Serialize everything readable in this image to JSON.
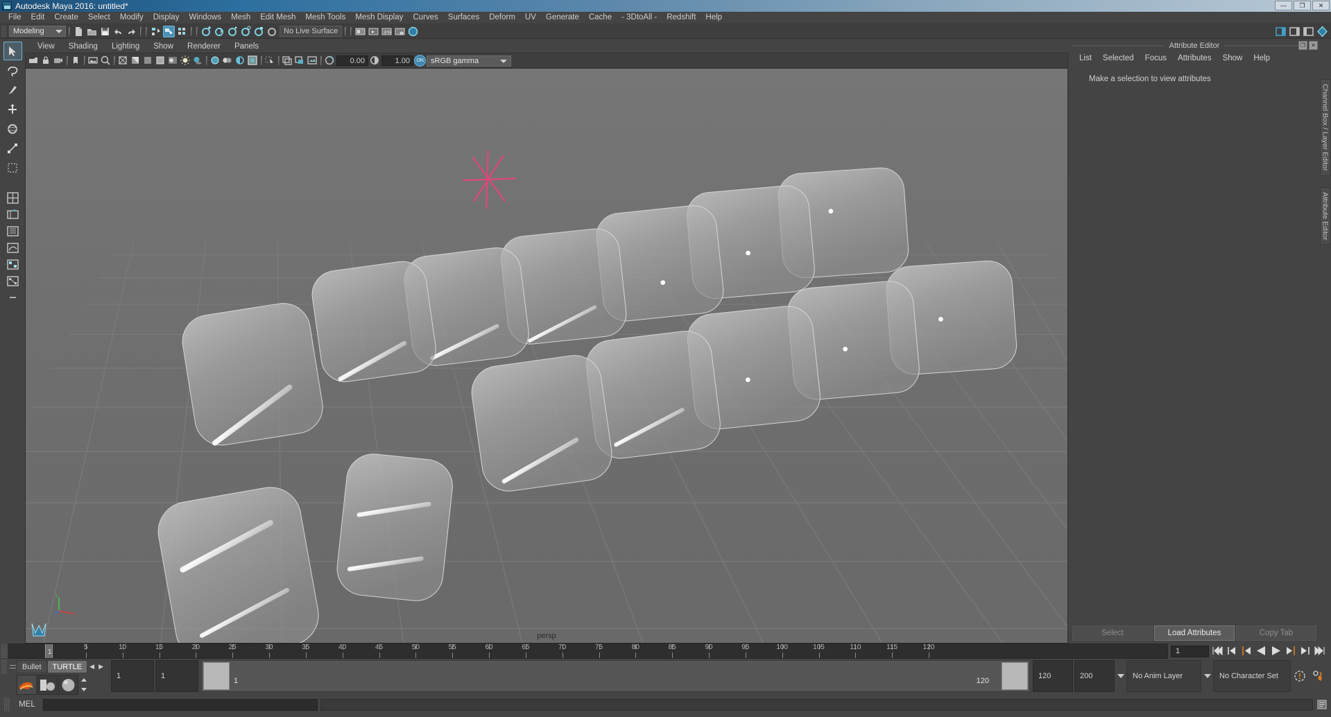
{
  "window": {
    "title": "Autodesk Maya 2016: untitled*",
    "app_icon": "maya-app-icon",
    "controls": {
      "minimize": "—",
      "maximize": "❐",
      "close": "✕"
    }
  },
  "main_menu": {
    "items": [
      "File",
      "Edit",
      "Create",
      "Select",
      "Modify",
      "Display",
      "Windows",
      "Mesh",
      "Edit Mesh",
      "Mesh Tools",
      "Mesh Display",
      "Curves",
      "Surfaces",
      "Deform",
      "UV",
      "Generate",
      "Cache",
      "- 3DtoAll -",
      "Redshift",
      "Help"
    ]
  },
  "status_line": {
    "menu_set": "Modeling",
    "live_surface": "No Live Surface",
    "icons": [
      "new-scene-icon",
      "open-scene-icon",
      "save-scene-icon",
      "undo-icon",
      "redo-icon",
      "select-by-hierarchy-icon",
      "select-by-object-icon",
      "select-by-component-icon",
      "snap-to-grid-icon",
      "snap-to-curve-icon",
      "snap-to-point-icon",
      "snap-to-projected-center-icon",
      "snap-to-view-plane-icon",
      "make-live-icon",
      "show-render-view-icon",
      "render-current-frame-icon",
      "ipr-render-icon",
      "render-settings-icon",
      "hypershade-icon"
    ],
    "right_icons": [
      "sidebar-toggle-icon",
      "attribute-editor-toggle-icon",
      "tool-settings-toggle-icon",
      "channel-box-toggle-icon"
    ]
  },
  "toolbox": {
    "items": [
      {
        "name": "select-tool",
        "active": true
      },
      {
        "name": "lasso-select-tool",
        "active": false
      },
      {
        "name": "paint-select-tool",
        "active": false
      },
      {
        "name": "move-tool",
        "active": false
      },
      {
        "name": "rotate-tool",
        "active": false
      },
      {
        "name": "scale-tool",
        "active": false
      },
      {
        "name": "last-tool-used",
        "active": false
      },
      {
        "name": "single-perspective-layout",
        "active": false
      },
      {
        "name": "four-view-layout",
        "active": false
      },
      {
        "name": "persp-outliner-layout",
        "active": false
      },
      {
        "name": "persp-graph-editor-layout",
        "active": false
      },
      {
        "name": "hypershade-persp-layout",
        "active": false
      },
      {
        "name": "persp-hypergraph-layout",
        "active": false
      },
      {
        "name": "more-layouts",
        "active": false
      }
    ]
  },
  "viewport": {
    "menus": [
      "View",
      "Shading",
      "Lighting",
      "Show",
      "Renderer",
      "Panels"
    ],
    "camera_label": "persp",
    "toolbar": {
      "exposure_value": "0.00",
      "gamma_value": "1.00",
      "color_management_toggle": "ON",
      "color_profile": "sRGB gamma",
      "icons": [
        "select-camera-icon",
        "lock-camera-icon",
        "camera-attributes-icon",
        "bookmarks-icon",
        "image-plane-icon",
        "two-d-pan-zoom-icon",
        "grid-toggle-icon",
        "film-gate-icon",
        "resolution-gate-icon",
        "gate-mask-icon",
        "xray-toggle-icon",
        "xray-joints-icon",
        "wireframe-toggle-icon",
        "smooth-shade-all-icon",
        "flat-shade-icon",
        "wireframe-on-shaded-icon",
        "texture-toggle-icon",
        "use-all-lights-icon",
        "shadows-icon",
        "screen-space-ao-icon",
        "motion-blur-icon",
        "multisample-aa-icon",
        "depth-of-field-icon",
        "isolate-select-icon",
        "grid-display-icon",
        "film-gate-display-icon",
        "exposure-icon",
        "gamma-icon"
      ]
    }
  },
  "attribute_editor": {
    "panel_title": "Attribute Editor",
    "menus": [
      "List",
      "Selected",
      "Focus",
      "Attributes",
      "Show",
      "Help"
    ],
    "empty_message": "Make a selection to view attributes",
    "buttons": [
      {
        "label": "Select",
        "enabled": false
      },
      {
        "label": "Load Attributes",
        "enabled": true
      },
      {
        "label": "Copy Tab",
        "enabled": false
      }
    ],
    "window_buttons": {
      "undock": "❐",
      "close": "✕"
    }
  },
  "vertical_tabs": [
    "Channel Box / Layer Editor",
    "Attribute Editor"
  ],
  "time_slider": {
    "current_frame": "1",
    "start_label": "1",
    "ticks": [
      5,
      10,
      15,
      20,
      25,
      30,
      35,
      40,
      45,
      50,
      55,
      60,
      65,
      70,
      75,
      80,
      85,
      90,
      95,
      100,
      105,
      110,
      115,
      120
    ],
    "frame_field": "1",
    "playback_buttons": [
      "go-to-start-icon",
      "step-back-frame-icon",
      "step-back-key-icon",
      "play-backwards-icon",
      "play-forwards-icon",
      "step-forward-key-icon",
      "step-forward-frame-icon",
      "go-to-end-icon"
    ]
  },
  "range_slider": {
    "shelf": {
      "tabs": [
        "Bullet",
        "TURTLE"
      ],
      "active_tab": "TURTLE",
      "prev_arrow": "◀",
      "next_arrow": "▶",
      "items": [
        "turtle-render-icon",
        "turtle-bake-icon",
        "turtle-sphere-icon"
      ]
    },
    "anim_start": "1",
    "anim_end_field": "1",
    "range_start": "1",
    "range_end": "120",
    "playback_end": "120",
    "anim_end": "200",
    "anim_layer": "No Anim Layer",
    "character_set": "No Character Set",
    "right_icons": [
      "auto-keyframe-icon",
      "animation-preferences-icon"
    ]
  },
  "command_line": {
    "label": "MEL",
    "input_value": "",
    "output_value": "",
    "script_editor_icon": "script-editor-icon"
  },
  "colors": {
    "accent_blue": "#4a90b5",
    "panel_bg": "#444444",
    "viewport_bg": "#6b6b6b",
    "title_gradient_start": "#1d4f77",
    "highlight_orange": "#e08020"
  }
}
